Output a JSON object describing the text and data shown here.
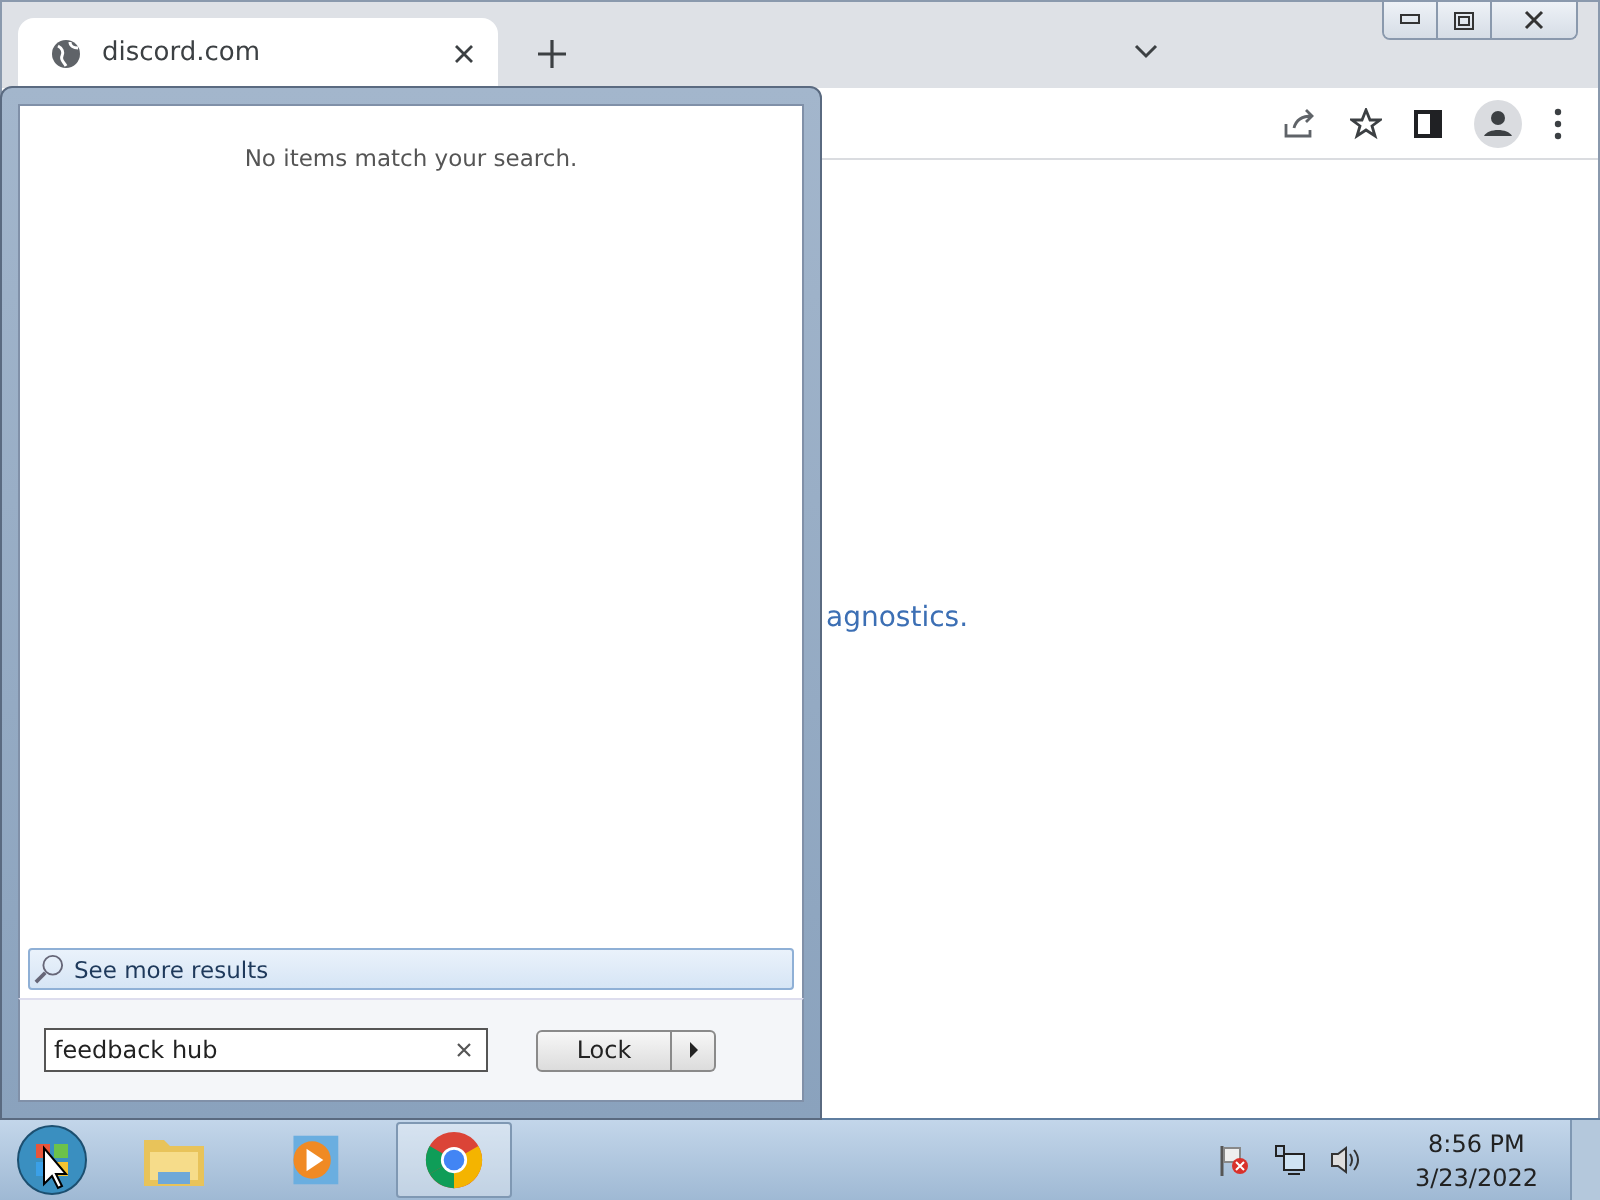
{
  "browser": {
    "tabs": [
      {
        "title": "discord.com",
        "selected": true
      }
    ],
    "content_text": "agnostics."
  },
  "start_menu": {
    "message": "No items match your search.",
    "see_more": "See more results",
    "search": {
      "value": "feedback hub"
    },
    "power_button": "Lock"
  },
  "taskbar": {
    "apps": [
      {
        "kind": "folder",
        "selected": false
      },
      {
        "kind": "media",
        "selected": false
      },
      {
        "kind": "chrome",
        "selected": true
      }
    ],
    "clock": {
      "time": "8:56 PM",
      "date": "3/23/2022"
    }
  }
}
